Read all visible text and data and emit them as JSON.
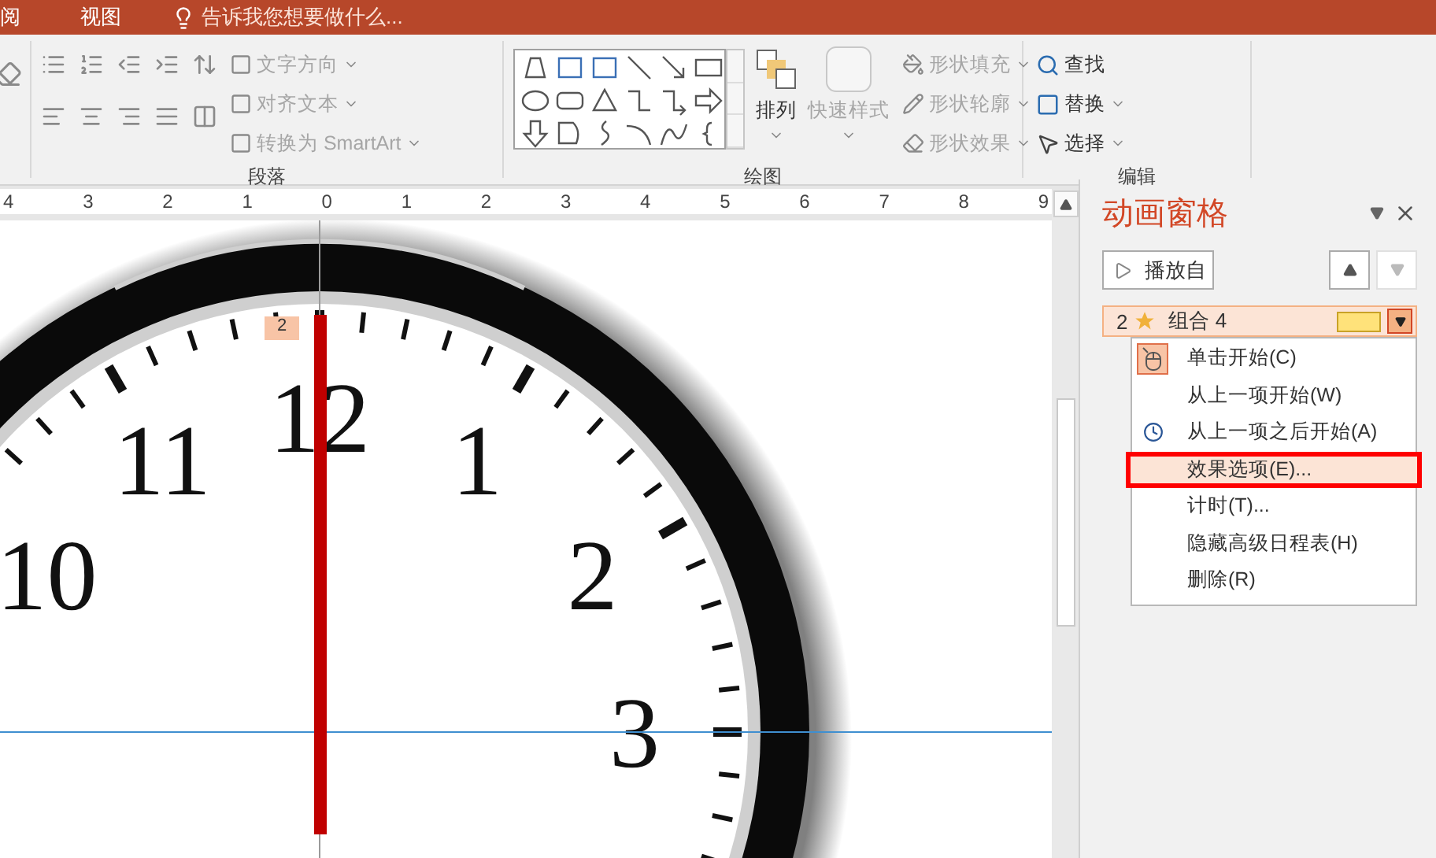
{
  "tabs": [
    {
      "label": "阅",
      "selected": false
    },
    {
      "label": "视图",
      "selected": false
    }
  ],
  "tell_me": {
    "placeholder": "告诉我您想要做什么..."
  },
  "ribbon": {
    "groups": [
      {
        "kind": "paragraph",
        "name": "段落",
        "commands": [
          {
            "label": "文字方向",
            "disabled": true
          },
          {
            "label": "对齐文本",
            "disabled": true
          },
          {
            "label": "转换为 SmartArt",
            "disabled": true
          }
        ]
      },
      {
        "kind": "drawing",
        "name": "绘图",
        "arrange": {
          "label": "排列",
          "disabled": false
        },
        "quick_styles": {
          "label": "快速样式",
          "disabled": true
        },
        "commands": [
          {
            "label": "形状填充",
            "disabled": true
          },
          {
            "label": "形状轮廓",
            "disabled": true
          },
          {
            "label": "形状效果",
            "disabled": true
          }
        ]
      },
      {
        "kind": "editing",
        "name": "编辑",
        "commands": [
          {
            "label": "查找",
            "disabled": false
          },
          {
            "label": "替换",
            "disabled": false
          },
          {
            "label": "选择",
            "disabled": false
          }
        ]
      }
    ]
  },
  "ruler": [
    "4",
    "3",
    "2",
    "1",
    "0",
    "1",
    "2",
    "3",
    "4",
    "5",
    "6",
    "7",
    "8",
    "9"
  ],
  "slide": {
    "numerals": [
      "12",
      "1",
      "2",
      "3",
      "11",
      "10"
    ],
    "animation_tag": "2"
  },
  "pane": {
    "title": "动画窗格",
    "play_button": "播放自",
    "items": [
      {
        "number": "2",
        "name": "组合 4",
        "selected": true
      }
    ],
    "menu": [
      {
        "label": "单击开始(C)",
        "kind": "mouse",
        "checked": true,
        "selected": false
      },
      {
        "label": "从上一项开始(W)",
        "kind": "plain",
        "checked": false,
        "selected": false
      },
      {
        "label": "从上一项之后开始(A)",
        "kind": "clock",
        "checked": false,
        "selected": false
      },
      {
        "label": "效果选项(E)...",
        "kind": "plain",
        "checked": false,
        "selected": true
      },
      {
        "label": "计时(T)...",
        "kind": "plain",
        "checked": false,
        "selected": false
      },
      {
        "label": "隐藏高级日程表(H)",
        "kind": "plain",
        "checked": false,
        "selected": false
      },
      {
        "label": "删除(R)",
        "kind": "plain",
        "checked": false,
        "selected": false
      }
    ]
  }
}
